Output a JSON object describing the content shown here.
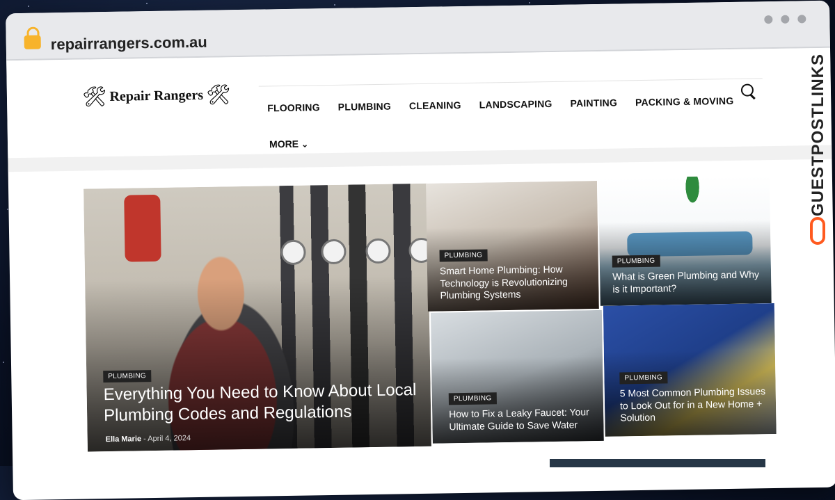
{
  "browser": {
    "url": "repairrangers.com.au",
    "watermark": "GUESTPOSTLINKS"
  },
  "site": {
    "logo_text": "Repair Rangers",
    "nav": [
      "FLOORING",
      "PLUMBING",
      "CLEANING",
      "LANDSCAPING",
      "PAINTING",
      "PACKING & MOVING"
    ],
    "more_label": "MORE"
  },
  "articles": {
    "main": {
      "category": "PLUMBING",
      "title": "Everything You Need to Know About Local Plumbing Codes and Regulations",
      "author": "Ella Marie",
      "separator": "-",
      "date": "April 4, 2024"
    },
    "top_left": {
      "category": "PLUMBING",
      "title": "Smart Home Plumbing: How Technology is Revolutionizing Plumbing Systems"
    },
    "top_right": {
      "category": "PLUMBING",
      "title": "What is Green Plumbing and Why is it Important?"
    },
    "bottom_left": {
      "category": "PLUMBING",
      "title": "How to Fix a Leaky Faucet: Your Ultimate Guide to Save Water"
    },
    "bottom_right": {
      "category": "PLUMBING",
      "title": "5 Most Common Plumbing Issues to Look Out for in a New Home + Solution"
    }
  }
}
